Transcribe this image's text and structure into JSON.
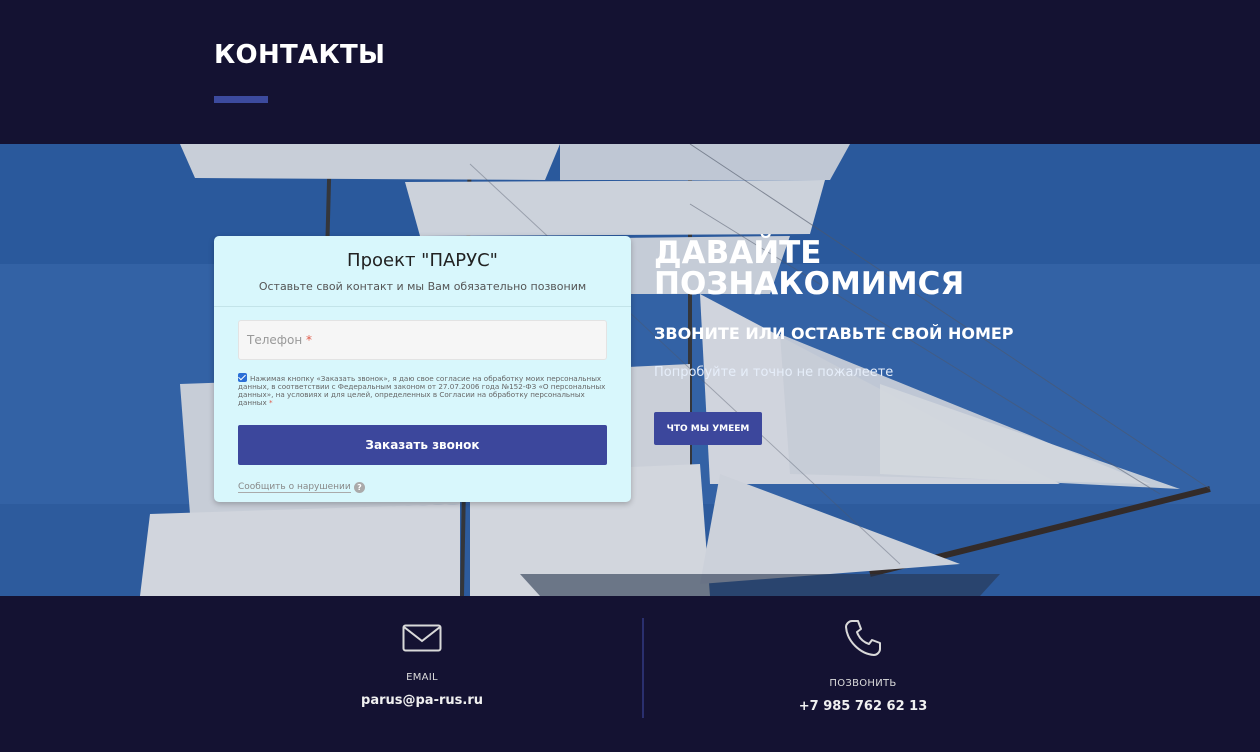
{
  "header": {
    "title": "КОНТАКТЫ"
  },
  "form": {
    "title": "Проект \"ПАРУС\"",
    "subtitle": "Оставьте свой контакт и мы Вам обязательно позвоним",
    "phone_placeholder": "Телефон",
    "required_mark": "*",
    "consent_text": "Нажимая кнопку «Заказать звонок», я даю свое согласие на обработку моих персональных данных, в соответствии с Федеральным законом от 27.07.2006 года №152-ФЗ «О персональных данных», на условиях и для целей, определенных в Согласии на обработку персональных данных",
    "consent_checked": true,
    "submit_label": "Заказать звонок",
    "report_link": "Сообщить о нарушении",
    "help_icon": "question-circle-icon"
  },
  "hero": {
    "headline": "ДАВАЙТЕ ПОЗНАКОМИМСЯ",
    "subheadline": "ЗВОНИТЕ ИЛИ ОСТАВЬТЕ СВОЙ НОМЕР",
    "tagline": "Попробуйте и точно не пожалеете",
    "button_label": "ЧТО МЫ УМЕЕМ"
  },
  "contacts": {
    "email": {
      "label": "EMAIL",
      "value": "parus@pa-rus.ru",
      "icon": "envelope-icon"
    },
    "phone": {
      "label": "ПОЗВОНИТЬ",
      "value": "+7 985 762 62 13",
      "icon": "phone-icon"
    }
  },
  "colors": {
    "background": "#141232",
    "accent": "#3c479c",
    "card": "#d8f7fc"
  }
}
